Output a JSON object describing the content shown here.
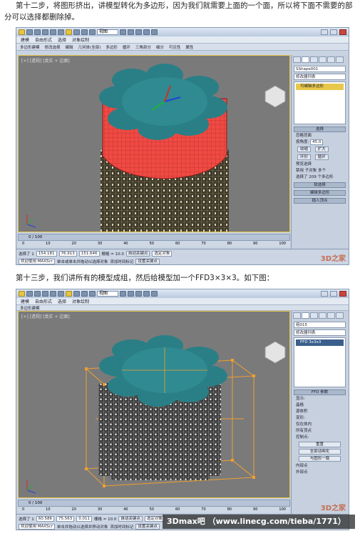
{
  "paragraphs": {
    "step12": "第十二步，将图形挤出，讲模型转化为多边形，因为我们就需要上面的一个面，所以将下面不需要的部分可以选择都删除掉。",
    "step13": "第十三步，我们讲所有的模型成组，然后给模型加一个FFD3×3×3。如下图："
  },
  "shot1": {
    "toolbar_select": "视图",
    "menu": [
      "建模",
      "自由形式",
      "选择",
      "对象绘制"
    ],
    "ribbon": [
      "多边形建模",
      "修改选择",
      "编辑",
      "几何体(全部)",
      "多边形",
      "循环",
      "三角剖分",
      "细分",
      "可见性",
      "属性"
    ],
    "viewport_label": "[+] [透视] [真实 + 边面]",
    "object_name": "SShape001",
    "modifier_list": "修改器列表",
    "stack_item": "可编辑多边形",
    "rollout_select": "选择",
    "opt_backface": "忽略背面",
    "opt_angle": "按角度:",
    "angle_value": "45.0",
    "btn_shrink": "收缩",
    "btn_grow": "扩大",
    "btn_ring": "环形",
    "btn_loop": "循环",
    "preview_select": "预览选择",
    "preview_off": "禁用",
    "preview_sub": "子对象",
    "preview_multi": "多个",
    "selected_info": "选择了 209 个多边形",
    "rollout_soft": "软选择",
    "rollout_edit": "编辑多边形",
    "rollout_insert": "插入顶点",
    "timeline": "0 / 100",
    "ruler": [
      "0",
      "10",
      "20",
      "30",
      "40",
      "50",
      "60",
      "70",
      "80",
      "90",
      "100"
    ],
    "status_selected": "选择了 1",
    "coord_x": "154.181",
    "coord_y": "76.913",
    "coord_z": "151.646",
    "grid": "栅格 = 10.0",
    "auto_key": "自动关键点",
    "set_key": "设置关键点",
    "key_filter": "选定对象",
    "welcome": "欢迎使用 MAXScr",
    "hint": "单击或单击并拖动以选择对象",
    "add_tag": "添加时间标记",
    "watermark": "3D之家"
  },
  "shot2": {
    "toolbar_select": "视图",
    "menu": [
      "建模",
      "自由形式",
      "选择",
      "对象绘制"
    ],
    "ribbon": [
      "多边形建模"
    ],
    "viewport_label": "[+] [透视] [真实 + 边面]",
    "object_name": "组015",
    "modifier_list": "修改器列表",
    "stack_item": "FFD 3x3x3",
    "rollout_params": "FFD 参数",
    "display_label": "显示:",
    "opt_lattice": "晶格",
    "opt_source": "源体积",
    "deform_label": "变形:",
    "opt_inside": "仅在体内",
    "opt_all": "所有顶点",
    "control_label": "控制点:",
    "btn_reset": "重置",
    "btn_anim_all": "全部动画化",
    "btn_conform": "与图形一致",
    "opt_inner": "内部点",
    "opt_outer": "外部点",
    "timeline": "0 / 100",
    "ruler": [
      "0",
      "10",
      "20",
      "30",
      "40",
      "50",
      "60",
      "70",
      "80",
      "90",
      "100"
    ],
    "status_selected": "选择了 1",
    "coord_x": "60.586",
    "coord_y": "75.563",
    "coord_z": "0.011",
    "grid": "栅格 = 10.0",
    "auto_key": "自动关键点",
    "set_key": "设置关键点",
    "key_filter": "选定对象",
    "welcome": "欢迎使用 MAXScr",
    "hint": "单击并拖动以选择并移动对象",
    "add_tag": "添加时间标记",
    "watermark": "3D之家"
  },
  "site_watermark": "3Dmax吧 （www.linecg.com/tieba/1771）"
}
